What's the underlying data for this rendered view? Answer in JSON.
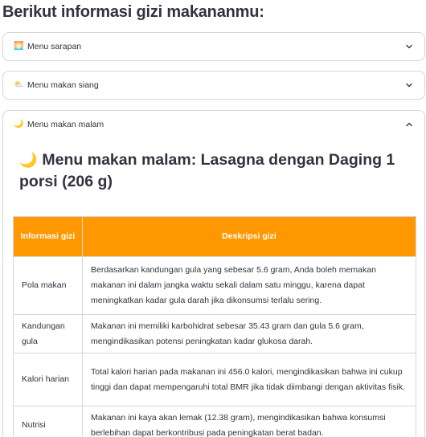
{
  "page": {
    "title": "Berikut informasi gizi makananmu:"
  },
  "expanders": [
    {
      "icon": "🌅",
      "icon_name": "sunrise-icon",
      "label": "Menu sarapan",
      "expanded": false
    },
    {
      "icon": "⛅",
      "icon_name": "sun-behind-cloud-icon",
      "label": "Menu makan siang",
      "expanded": false
    },
    {
      "icon": "🌙",
      "icon_name": "crescent-moon-icon",
      "label": "Menu makan malam",
      "expanded": true
    }
  ],
  "dinner": {
    "icon": "🌙",
    "title": "Menu makan malam: Lasagna dengan Daging 1 porsi (206 g)",
    "table": {
      "headers": [
        "Informasi gizi",
        "Deskripsi gizi"
      ],
      "rows": [
        {
          "key": "Pola makan",
          "desc": "Berdasarkan kandungan gula yang sebesar 5.6 gram, Anda boleh memakan makanan ini dalam jangka waktu sekali dalam satu minggu, karena dapat meningkatkan kadar gula darah jika dikonsumsi terlalu sering."
        },
        {
          "key": "Kandungan gula",
          "desc": "Makanan ini memiliki karbohidrat sebesar 35.43 gram dan gula 5.6 gram, mengindikasikan potensi peningkatan kadar glukosa darah."
        },
        {
          "key": "Kalori harian",
          "desc": "Total kalori harian pada makanan ini 456.0 kalori, mengindikasikan bahwa ini cukup tinggi dan dapat mempengaruhi total BMR jika tidak diimbangi dengan aktivitas fisik."
        },
        {
          "key": "Nutrisi",
          "desc": "Makanan ini kaya akan lemak (12.38 gram), mengindikasikan bahwa konsumsi berlebihan dapat berkontribusi pada peningkatan berat badan."
        }
      ]
    }
  },
  "colors": {
    "header_bg": "#ff9800",
    "border": "#d6d6d9",
    "text": "#31333f"
  }
}
